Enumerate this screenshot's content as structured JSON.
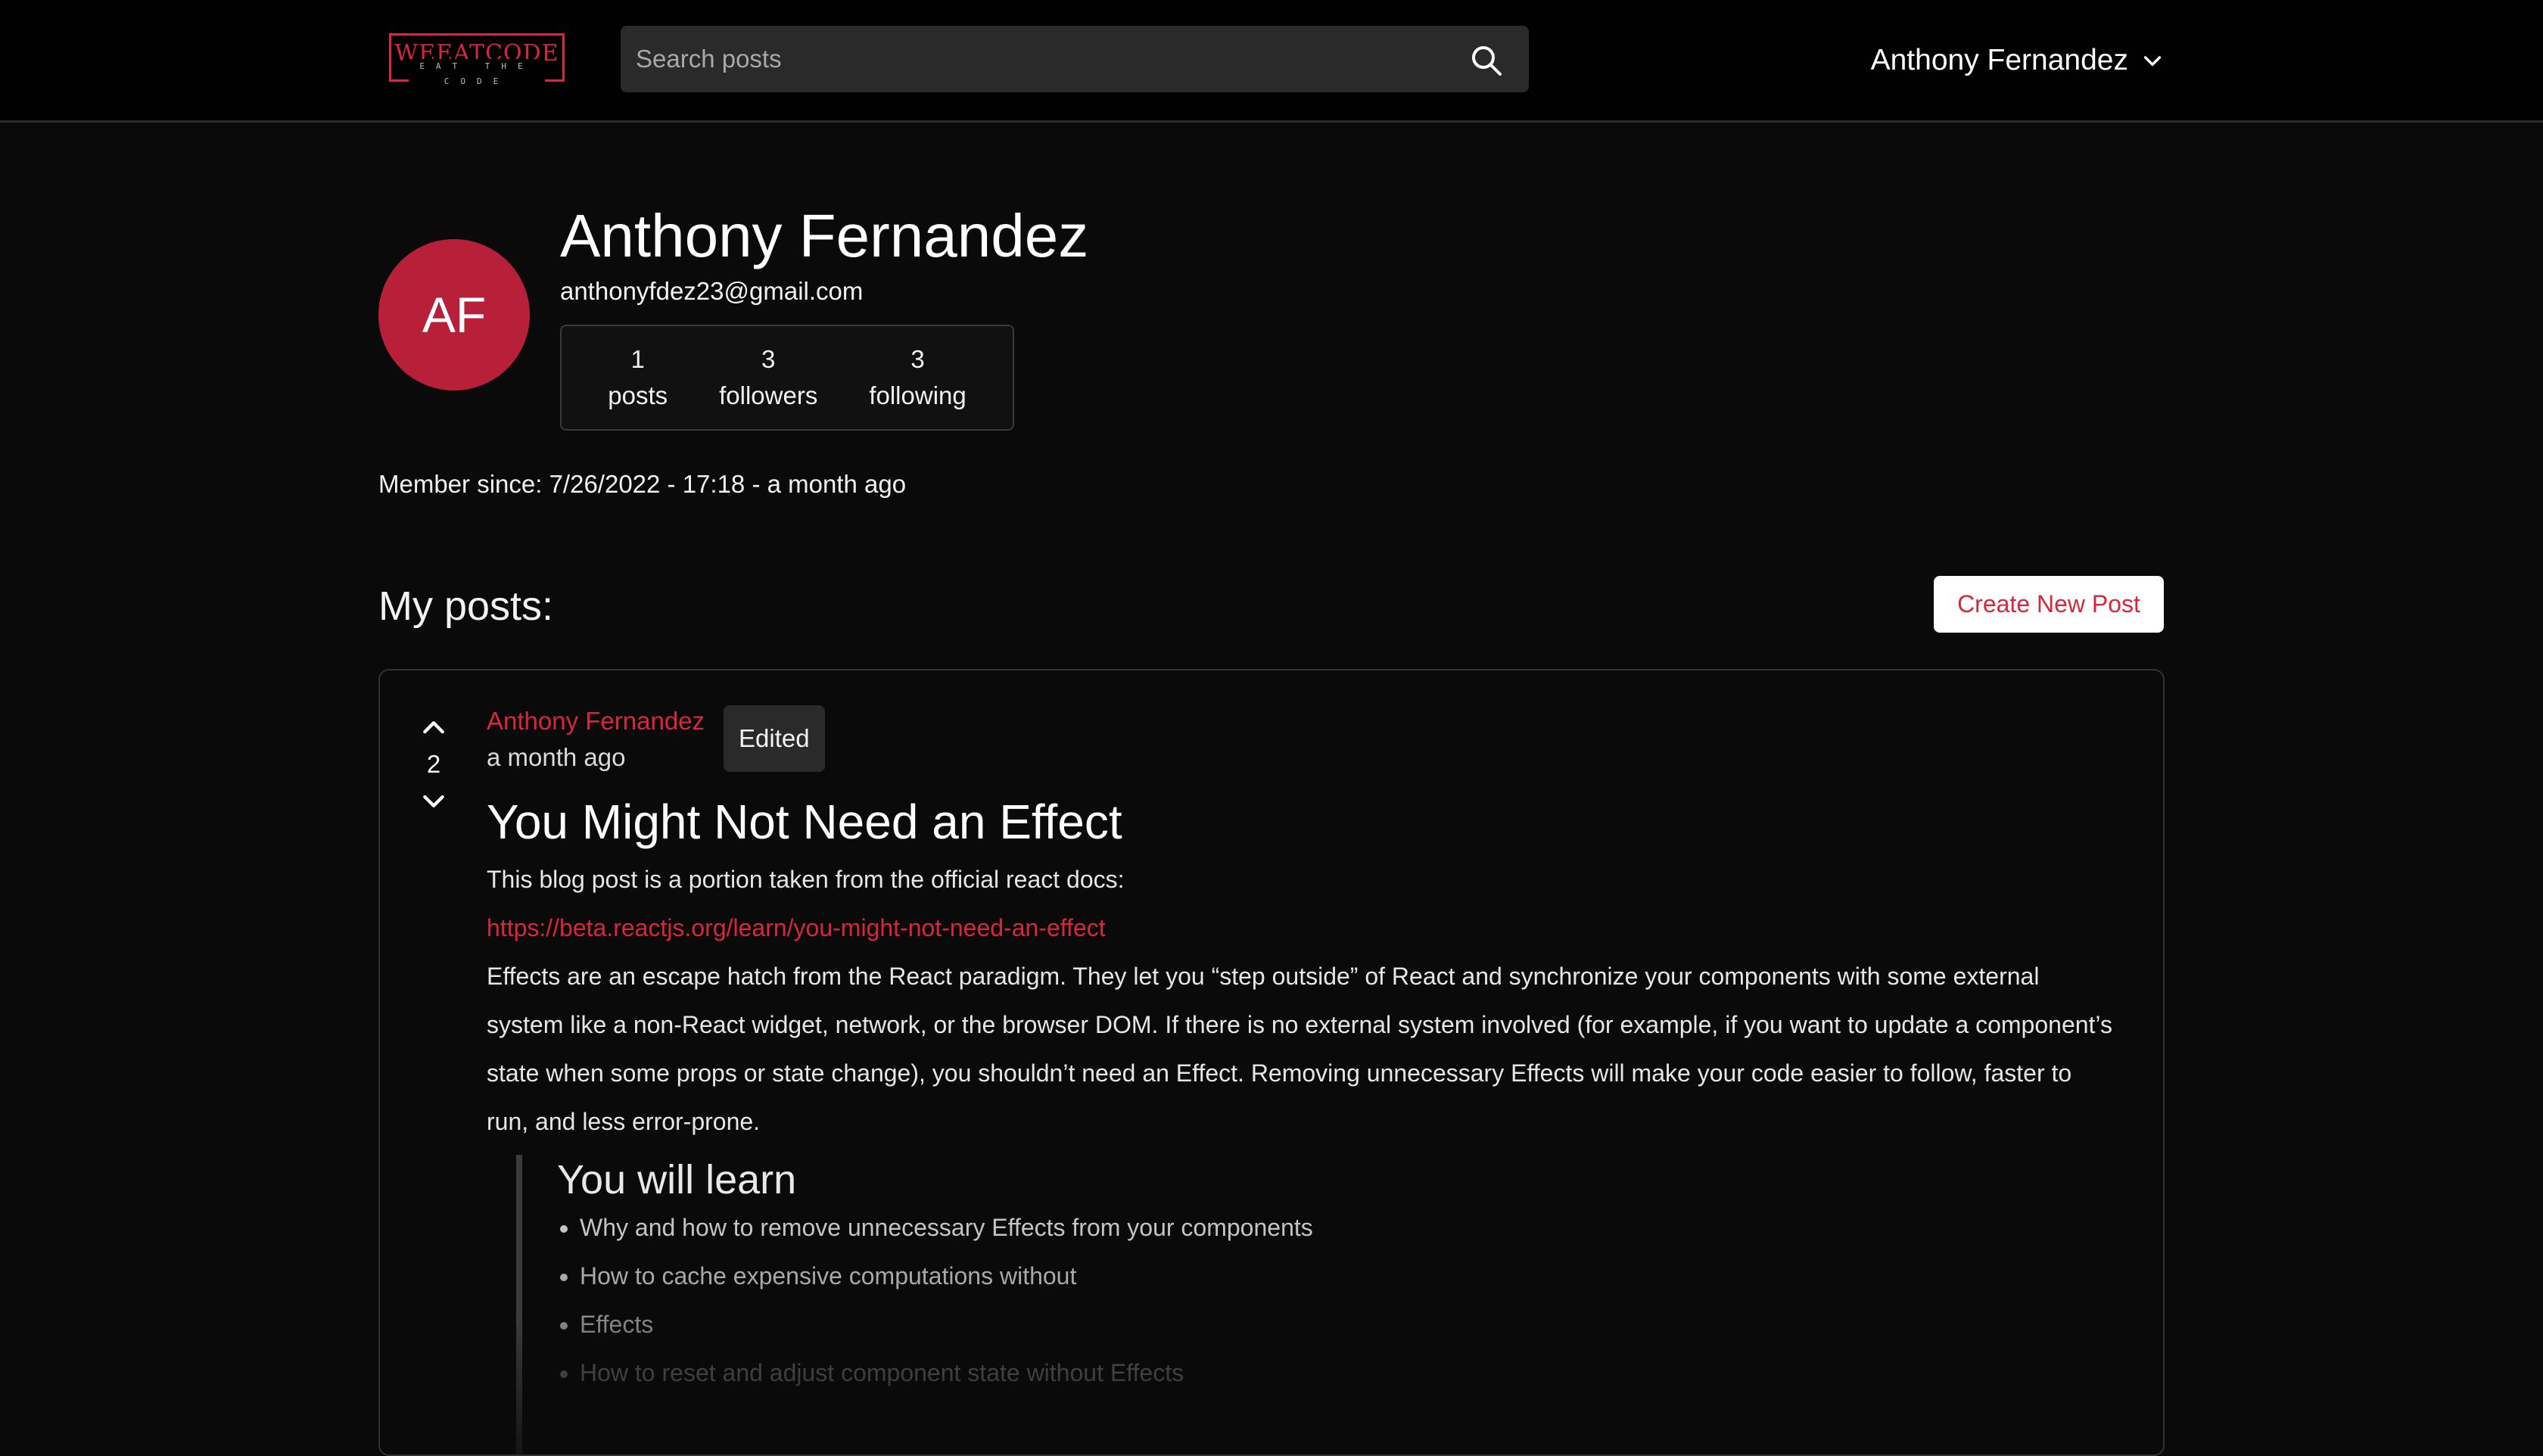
{
  "brand": {
    "logo_text": "WEEATCODE",
    "tagline": "EAT THE CODE",
    "accent_color": "#d6273c"
  },
  "search": {
    "placeholder": "Search posts",
    "icon": "search-icon"
  },
  "user_menu": {
    "name": "Anthony Fernandez",
    "icon": "chevron-down-icon"
  },
  "profile": {
    "initials": "AF",
    "name": "Anthony Fernandez",
    "email": "anthonyfdez23@gmail.com",
    "avatar_color": "#b72038",
    "stats": [
      {
        "count": "1",
        "label": "posts"
      },
      {
        "count": "3",
        "label": "followers"
      },
      {
        "count": "3",
        "label": "following"
      }
    ],
    "member_since": "Member since: 7/26/2022 - 17:18 - a month ago"
  },
  "posts_section": {
    "heading": "My posts:",
    "create_button": "Create New Post"
  },
  "post": {
    "votes": "2",
    "author": "Anthony Fernandez",
    "time": "a month ago",
    "edited_label": "Edited",
    "title": "You Might Not Need an Effect",
    "intro": "This blog post is a portion taken from the official react docs:",
    "link": "https://beta.reactjs.org/learn/you-might-not-need-an-effect",
    "paragraph": "Effects are an escape hatch from the React paradigm. They let you “step outside” of React and synchronize your components with some external system like a non-React widget, network, or the browser DOM. If there is no external system involved (for example, if you want to update a component’s state when some props or state change), you shouldn’t need an Effect. Removing unnecessary Effects will make your code easier to follow, faster to run, and less error-prone.",
    "quote_title": "You will learn",
    "learn_items": [
      "Why and how to remove unnecessary Effects from your components",
      "How to cache expensive computations without",
      "Effects",
      "How to reset and adjust component state without Effects"
    ]
  }
}
